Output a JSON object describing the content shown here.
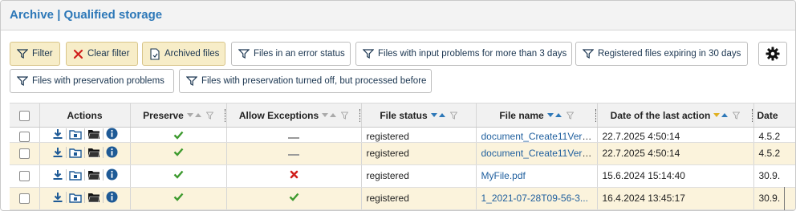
{
  "header": {
    "title": "Archive | Qualified storage"
  },
  "toolbar": {
    "filter_label": "Filter",
    "clear_filter_label": "Clear filter",
    "archived_files_label": "Archived files",
    "error_status_label": "Files in an error status",
    "input_problems_label": "Files with input problems for more than 3 days",
    "expiring_label": "Registered files expiring in 30 days",
    "preservation_problems_label": "Files with preservation problems",
    "preservation_off_label": "Files with preservation turned off, but processed before"
  },
  "table": {
    "headers": {
      "actions": "Actions",
      "preserve": "Preserve",
      "allow_exceptions": "Allow Exceptions",
      "file_status": "File status",
      "file_name": "File name",
      "last_action": "Date of the last action",
      "date_next": "Date"
    },
    "rows": [
      {
        "preserve": "check",
        "exceptions": "dash",
        "status": "registered",
        "file_name": "document_Create11Vers...",
        "last_action": "22.7.2025 4:50:14",
        "date_next": "4.5.2"
      },
      {
        "preserve": "check",
        "exceptions": "dash",
        "status": "registered",
        "file_name": "document_Create11Vers...",
        "last_action": "22.7.2025 4:50:14",
        "date_next": "4.5.2"
      },
      {
        "preserve": "check",
        "exceptions": "cross",
        "status": "registered",
        "file_name": "MyFile.pdf",
        "last_action": "15.6.2024 15:14:40",
        "date_next": "30.9."
      },
      {
        "preserve": "check",
        "exceptions": "check",
        "status": "registered",
        "file_name": "1_2021-07-28T09-56-3...",
        "last_action": "16.4.2024 13:45:17",
        "date_next": "30.9."
      }
    ]
  },
  "colors": {
    "title": "#2d78b8",
    "active_button": "#f7edc8",
    "row_alt": "#fbf3dc",
    "link": "#1f5f9e",
    "check": "#3d9a2e",
    "cross": "#d0201c",
    "sort_blue": "#2d78b8",
    "sort_yellow": "#e0b020"
  },
  "icons": {
    "filter": "funnel-icon",
    "clear": "cross-icon",
    "archived": "archive-document-icon",
    "settings": "gear-icon",
    "download": "download-icon",
    "folder_shared": "shared-folder-icon",
    "folder": "folder-icon",
    "info": "info-icon"
  }
}
